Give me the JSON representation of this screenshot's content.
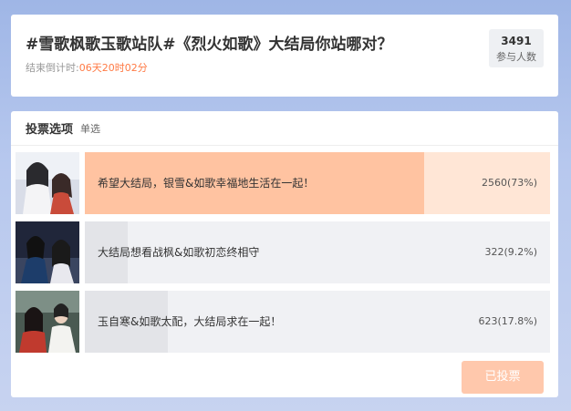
{
  "poll": {
    "title": "#雪歌枫歌玉歌站队#《烈火如歌》大结局你站哪对？",
    "countdown_label": "结束倒计时:",
    "countdown_time": "06天20时02分",
    "participant_count": "3491",
    "participant_label": "参与人数"
  },
  "vote": {
    "header": "投票选项",
    "mode": "单选",
    "button_label": "已投票",
    "options": [
      {
        "text": "希望大结局，银雪&如歌幸福地生活在一起！",
        "count": "2560(73%)",
        "fraction": 0.73,
        "selected": true
      },
      {
        "text": "大结局想看战枫&如歌初恋终相守",
        "count": "322(9.2%)",
        "fraction": 0.092,
        "selected": false
      },
      {
        "text": "玉自寒&如歌太配，大结局求在一起！",
        "count": "623(17.8%)",
        "fraction": 0.178,
        "selected": false
      }
    ]
  },
  "colors": {
    "selected_fill": "#ffc3a1",
    "selected_track": "#ffe6d6",
    "unselected_fill": "#e3e4e8",
    "unselected_track": "#f0f1f4",
    "accent": "#ff7a45"
  }
}
